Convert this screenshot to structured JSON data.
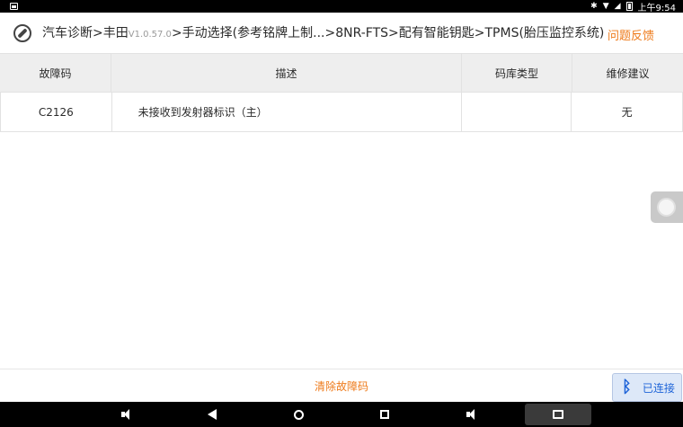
{
  "status_bar": {
    "time": "上午9:54"
  },
  "header": {
    "path_start": "汽车诊断>丰田",
    "version": "V1.0.57.0",
    "path_end": ">手动选择(参考铭牌上制...>8NR-FTS>配有智能钥匙>TPMS(胎压监控系统)",
    "feedback_label": "问题反馈"
  },
  "table": {
    "columns": [
      "故障码",
      "描述",
      "码库类型",
      "维修建议"
    ],
    "rows": [
      {
        "code": "C2126",
        "description": "未接收到发射器标识（主）",
        "library_type": "",
        "advice": "无"
      }
    ]
  },
  "action_bar": {
    "clear_label": "清除故障码",
    "bluetooth_label": "已连接"
  },
  "colors": {
    "accent": "#ee7a1a",
    "bluetooth": "#1e64d8"
  }
}
